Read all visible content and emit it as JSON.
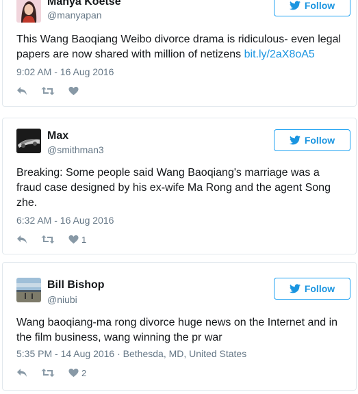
{
  "tweets": [
    {
      "name": "Manya Koetse",
      "handle": "@manyapan",
      "follow_label": "Follow",
      "text": "This Wang Baoqiang Weibo divorce drama is ridiculous- even legal papers are now shared with million of netizens ",
      "link": "bit.ly/2aX8oA5",
      "time": "9:02 AM - 16 Aug 2016",
      "likes": ""
    },
    {
      "name": "Max",
      "handle": "@smithman3",
      "follow_label": "Follow",
      "text": "Breaking: Some people said Wang Baoqiang's marriage was a fraud case designed by his ex-wife Ma Rong and the agent Song zhe.",
      "time": "6:32 AM - 16 Aug 2016",
      "likes": "1"
    },
    {
      "name": "Bill Bishop",
      "handle": "@niubi",
      "follow_label": "Follow",
      "text": "Wang baoqiang-ma rong divorce huge news on the Internet and in the film business, wang winning the pr war",
      "time": "5:35 PM - 14 Aug 2016 · Bethesda, MD, United States",
      "likes": "2"
    }
  ],
  "colors": {
    "accent": "#1da1f2",
    "link": "#1b95e0",
    "muted": "#657786",
    "border": "#e1e8ed"
  },
  "icons": [
    "twitter-bird-icon",
    "reply-icon",
    "retweet-icon",
    "heart-icon"
  ]
}
